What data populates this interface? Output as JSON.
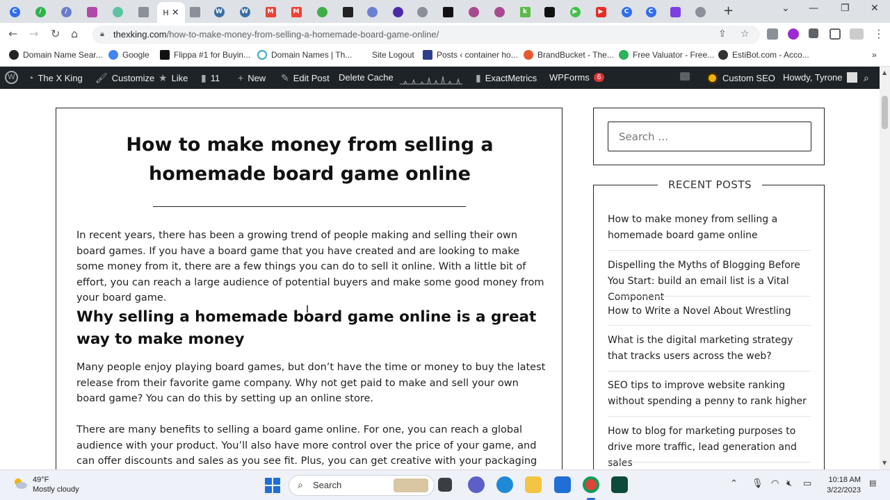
{
  "browser": {
    "active_tab_label": "H",
    "url_host": "thexking.com",
    "url_path": "/how-to-make-money-from-selling-a-homemade-board-game-online/",
    "new_tab_symbol": "+",
    "bookmarks": [
      "Domain Name Sear...",
      "Google",
      "Flippa #1 for Buyin...",
      "Domain Names | Th...",
      "Site Logout",
      "Posts ‹ container ho...",
      "BrandBucket - The...",
      "Free Valuator - Free...",
      "EstiBot.com - Acco..."
    ],
    "bookmark_overflow": "»"
  },
  "adminbar": {
    "site_name": "The X King",
    "customize": "Customize",
    "like": "Like",
    "comments_count": "11",
    "new": "New",
    "edit_post": "Edit Post",
    "delete_cache": "Delete Cache",
    "exactmetrics": "ExactMetrics",
    "wpforms": "WPForms",
    "wpforms_badge": "6",
    "custom_seo": "Custom SEO",
    "howdy": "Howdy, Tyrone"
  },
  "article": {
    "title": "How to make money from selling a homemade board game online",
    "intro": "In recent years, there has been a growing trend of people making and selling their own board games. If you have a board game that you have created and are looking to make some money from it, there are a few things you can do to sell it online. With a little bit of effort, you can reach a large audience of potential buyers and make some good money from your board game.",
    "h2": "Why selling a homemade board game online is a great way to make money",
    "p2": "Many people enjoy playing board games, but don’t have the time or money to buy the latest release from their favorite game company. Why not get paid to make and sell your own board game? You can do this by setting up an online store.",
    "p3": "There are many benefits to selling a board game online. For one, you can reach a global audience with your product. You’ll also have more control over the price of your game, and can offer discounts and sales as you see fit. Plus, you can get creative with your packaging and"
  },
  "sidebar": {
    "search_placeholder": "Search …",
    "recent_title": "RECENT POSTS",
    "recent_posts": [
      "How to make money from selling a homemade board game online",
      "Dispelling the Myths of Blogging Before You Start: build an email list is a Vital Component",
      "How to Write a Novel About Wrestling",
      "What is the digital marketing strategy that tracks users across the web?",
      "SEO tips to improve website ranking without spending a penny to rank higher",
      "How to blog for marketing purposes to drive more traffic, lead generation and sales"
    ]
  },
  "taskbar": {
    "temperature": "49°F",
    "weather": "Mostly cloudy",
    "search_label": "Search",
    "time": "10:18 AM",
    "date": "3/22/2023"
  },
  "colors": {
    "adminbar_bg": "#1d2327",
    "accent_blue": "#1f6fd6",
    "badge_red": "#d63638"
  }
}
